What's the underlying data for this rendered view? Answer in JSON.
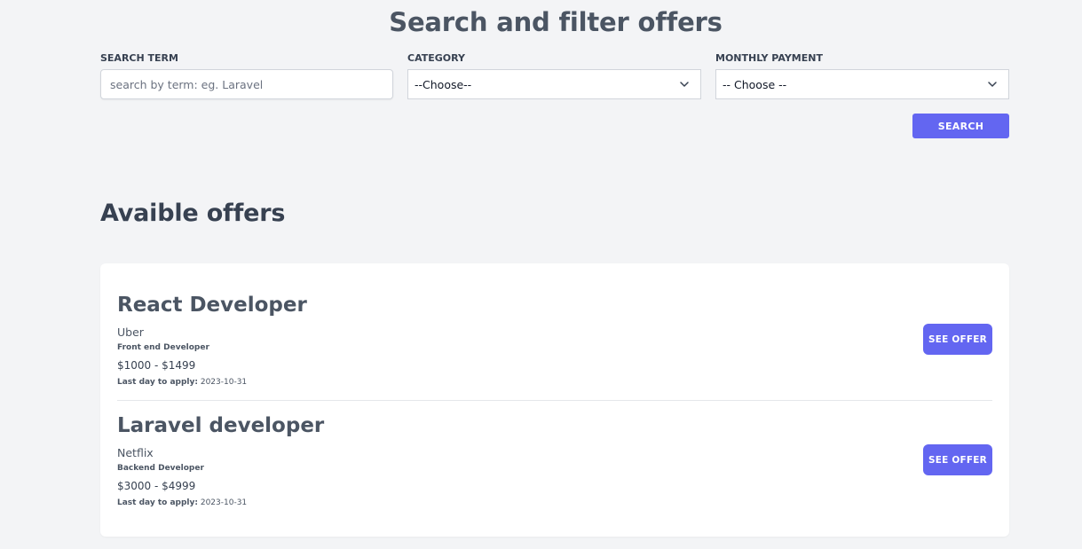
{
  "search_form": {
    "title": "Search and filter offers",
    "search_term_label": "SEARCH TERM",
    "search_term_placeholder": "search by term: eg. Laravel",
    "search_term_value": "",
    "category_label": "CATEGORY",
    "category_selected": "--Choose--",
    "payment_label": "MONTHLY PAYMENT",
    "payment_selected": "-- Choose --",
    "submit_label": "SEARCH"
  },
  "offers_section": {
    "title": "Avaible offers",
    "offers": [
      {
        "title": "React Developer",
        "company": "Uber",
        "category": "Front end Developer",
        "salary": "$1000 - $1499",
        "deadline_label": "Last day to apply:",
        "deadline": "2023-10-31",
        "button_label": "SEE OFFER"
      },
      {
        "title": "Laravel developer",
        "company": "Netflix",
        "category": "Backend Developer",
        "salary": "$3000 - $4999",
        "deadline_label": "Last day to apply:",
        "deadline": "2023-10-31",
        "button_label": "SEE OFFER"
      }
    ]
  },
  "colors": {
    "background": "#f3f4f6",
    "accent": "#6366f1",
    "card": "#ffffff"
  },
  "icons": {
    "select_chevron": "chevron-down-icon"
  }
}
